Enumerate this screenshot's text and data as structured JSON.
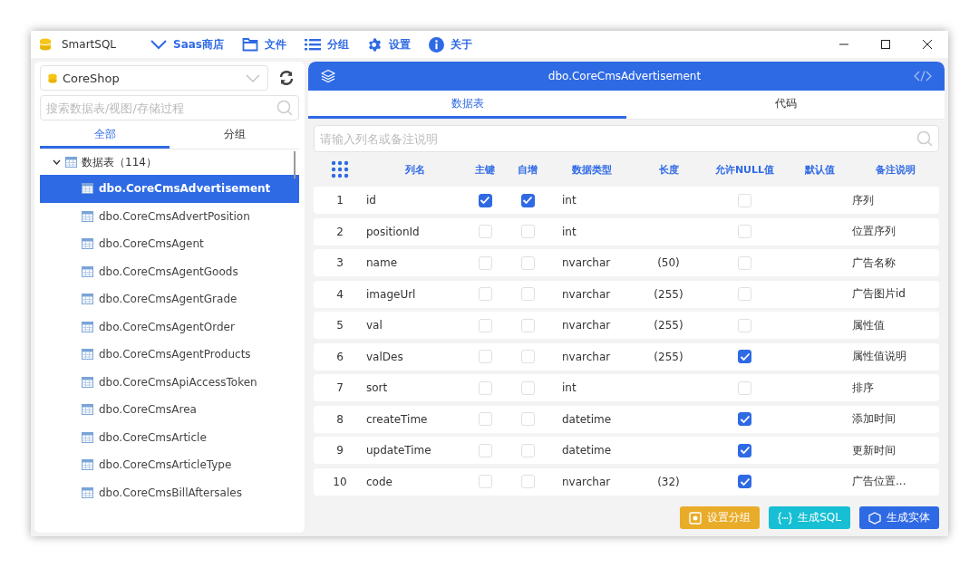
{
  "window": {
    "title": "SmartSQL"
  },
  "menu": [
    {
      "label": "Saas商店"
    },
    {
      "label": "文件"
    },
    {
      "label": "分组"
    },
    {
      "label": "设置"
    },
    {
      "label": "关于"
    }
  ],
  "sidebar": {
    "database": "CoreShop",
    "search": {
      "placeholder": "搜索数据表/视图/存储过程"
    },
    "tabs": [
      {
        "label": "全部",
        "selected": true
      },
      {
        "label": "分组",
        "selected": false
      }
    ],
    "tree": [
      {
        "label": "数据表（114）",
        "expanded": true,
        "children": [
          {
            "label": "dbo.CoreCmsAdvertisement",
            "selected": true
          },
          {
            "label": "dbo.CoreCmsAdvertPosition",
            "selected": false
          },
          {
            "label": "dbo.CoreCmsAgent",
            "selected": false
          },
          {
            "label": "dbo.CoreCmsAgentGoods",
            "selected": false
          },
          {
            "label": "dbo.CoreCmsAgentGrade",
            "selected": false
          },
          {
            "label": "dbo.CoreCmsAgentOrder",
            "selected": false
          },
          {
            "label": "dbo.CoreCmsAgentProducts",
            "selected": false
          },
          {
            "label": "dbo.CoreCmsApiAccessToken",
            "selected": false
          },
          {
            "label": "dbo.CoreCmsArea",
            "selected": false
          },
          {
            "label": "dbo.CoreCmsArticle",
            "selected": false
          },
          {
            "label": "dbo.CoreCmsArticleType",
            "selected": false
          },
          {
            "label": "dbo.CoreCmsBillAftersales",
            "selected": false
          }
        ]
      }
    ]
  },
  "content": {
    "title": "dbo.CoreCmsAdvertisement",
    "tabs": [
      {
        "label": "数据表",
        "selected": true
      },
      {
        "label": "代码",
        "selected": false
      }
    ],
    "search": {
      "placeholder": "请输入列名或备注说明"
    },
    "table": {
      "columns": [
        "列名",
        "主键",
        "自增",
        "数据类型",
        "长度",
        "允许NULL值",
        "默认值",
        "备注说明"
      ],
      "rows": [
        {
          "no": "1",
          "name": "id",
          "primary_key": true,
          "identity": true,
          "type": "int",
          "nullable": false,
          "comment": "序列"
        },
        {
          "no": "2",
          "name": "positionId",
          "primary_key": false,
          "identity": false,
          "type": "int",
          "nullable": false,
          "comment": "位置序列"
        },
        {
          "no": "3",
          "name": "name",
          "primary_key": false,
          "identity": false,
          "type": "nvarchar",
          "length": "(50)",
          "nullable": false,
          "comment": "广告名称"
        },
        {
          "no": "4",
          "name": "imageUrl",
          "primary_key": false,
          "identity": false,
          "type": "nvarchar",
          "length": "(255)",
          "nullable": false,
          "comment": "广告图片id"
        },
        {
          "no": "5",
          "name": "val",
          "primary_key": false,
          "identity": false,
          "type": "nvarchar",
          "length": "(255)",
          "nullable": false,
          "comment": "属性值"
        },
        {
          "no": "6",
          "name": "valDes",
          "primary_key": false,
          "identity": false,
          "type": "nvarchar",
          "length": "(255)",
          "nullable": true,
          "comment": "属性值说明"
        },
        {
          "no": "7",
          "name": "sort",
          "primary_key": false,
          "identity": false,
          "type": "int",
          "nullable": false,
          "comment": "排序"
        },
        {
          "no": "8",
          "name": "createTime",
          "primary_key": false,
          "identity": false,
          "type": "datetime",
          "nullable": true,
          "comment": "添加时间"
        },
        {
          "no": "9",
          "name": "updateTime",
          "primary_key": false,
          "identity": false,
          "type": "datetime",
          "nullable": true,
          "comment": "更新时间"
        },
        {
          "no": "10",
          "name": "code",
          "primary_key": false,
          "identity": false,
          "type": "nvarchar",
          "length": "(32)",
          "nullable": true,
          "comment": "广告位置..."
        }
      ]
    },
    "buttons": [
      {
        "label": "设置分组",
        "kind": "group"
      },
      {
        "label": "生成SQL",
        "kind": "sql"
      },
      {
        "label": "生成实体",
        "kind": "entity"
      }
    ]
  }
}
